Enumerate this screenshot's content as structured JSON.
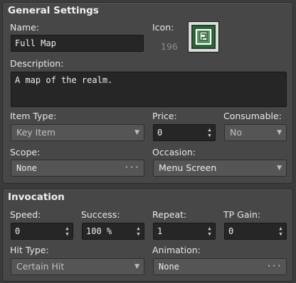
{
  "general": {
    "title": "General Settings",
    "name_label": "Name:",
    "name_value": "Full Map",
    "icon_label": "Icon:",
    "icon_index": "196",
    "icon_name": "map-icon",
    "description_label": "Description:",
    "description_value": "A map of the realm.",
    "item_type_label": "Item Type:",
    "item_type_value": "Key Item",
    "price_label": "Price:",
    "price_value": "0",
    "consumable_label": "Consumable:",
    "consumable_value": "No",
    "scope_label": "Scope:",
    "scope_value": "None",
    "occasion_label": "Occasion:",
    "occasion_value": "Menu Screen"
  },
  "invocation": {
    "title": "Invocation",
    "speed_label": "Speed:",
    "speed_value": "0",
    "success_label": "Success:",
    "success_value": "100 %",
    "repeat_label": "Repeat:",
    "repeat_value": "1",
    "tp_gain_label": "TP Gain:",
    "tp_gain_value": "0",
    "hit_type_label": "Hit Type:",
    "hit_type_value": "Certain Hit",
    "animation_label": "Animation:",
    "animation_value": "None"
  },
  "glyphs": {
    "dropdown": "▼",
    "ellipsis": "···",
    "spin_up": "▲",
    "spin_down": "▼"
  },
  "colors": {
    "panel": "#474747",
    "background": "#3b3b3b",
    "field": "#262626",
    "combo": "#555555",
    "icon_green": "#2f6b3b"
  }
}
